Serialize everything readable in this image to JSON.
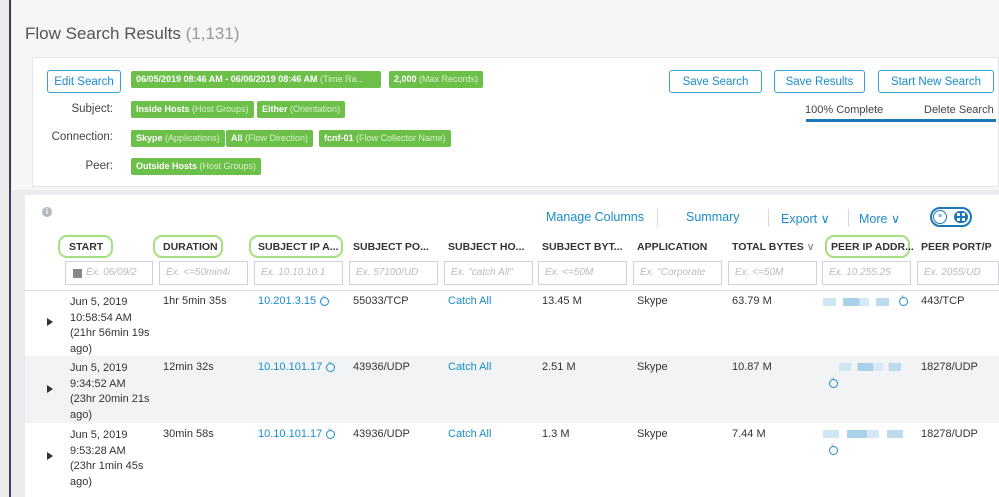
{
  "page": {
    "title": "Flow Search Results",
    "count": "(1,131)"
  },
  "search": {
    "edit_label": "Edit Search",
    "time_tag": {
      "bold": "06/05/2019 08:46 AM - 06/06/2019 08:46 AM",
      "light": "(Time Ra..."
    },
    "max_tag": {
      "bold": "2,000",
      "light": "(Max Records)"
    },
    "subject_label": "Subject:",
    "subject_tags": [
      {
        "bold": "Inside Hosts",
        "light": "(Host Groups)"
      },
      {
        "bold": "Either",
        "light": "(Orientation)"
      }
    ],
    "connection_label": "Connection:",
    "connection_tags": [
      {
        "bold": "Skype",
        "light": "(Applications)"
      },
      {
        "bold": "All",
        "light": "(Flow Direction)"
      },
      {
        "bold": "fcnf-01",
        "light": "(Flow Collector Name)"
      }
    ],
    "peer_label": "Peer:",
    "peer_tags": [
      {
        "bold": "Outside Hosts",
        "light": "(Host Groups)"
      }
    ],
    "save_search": "Save Search",
    "save_results": "Save Results",
    "start_new": "Start New Search",
    "progress_text": "100% Complete",
    "progress": 1.0,
    "delete_search": "Delete Search"
  },
  "toolbar": {
    "manage_columns": "Manage Columns",
    "summary": "Summary",
    "export": "Export",
    "more": "More",
    "chevron": "∨"
  },
  "columns": [
    {
      "label": "START",
      "placeholder": "Ex. 06/09/2"
    },
    {
      "label": "DURATION",
      "placeholder": "Ex. <=50min4i"
    },
    {
      "label": "SUBJECT IP A...",
      "placeholder": "Ex. 10.10.10.1"
    },
    {
      "label": "SUBJECT PO...",
      "placeholder": "Ex. 57100/UD"
    },
    {
      "label": "SUBJECT HO...",
      "placeholder": "Ex. \"catch All\""
    },
    {
      "label": "SUBJECT BYT...",
      "placeholder": "Ex. <=50M"
    },
    {
      "label": "APPLICATION",
      "placeholder": "Ex. \"Corporate"
    },
    {
      "label": "TOTAL BYTES",
      "placeholder": "Ex. <=50M"
    },
    {
      "label": "PEER IP ADDR...",
      "placeholder": "Ex. 10.255.25"
    },
    {
      "label": "PEER PORT/P",
      "placeholder": "Ex. 2055/UD"
    }
  ],
  "rows": [
    {
      "start": [
        "Jun 5, 2019",
        "10:58:54 AM",
        "(21hr 56min 19s",
        "ago)"
      ],
      "duration": "1hr 5min 35s",
      "subject_ip": "10.201.3.15",
      "subject_port": "55033/TCP",
      "subject_host": "Catch All",
      "subject_bytes": "13.45 M",
      "application": "Skype",
      "total_bytes": "63.79 M",
      "peer_port": "443/TCP"
    },
    {
      "start": [
        "Jun 5, 2019",
        "9:34:52 AM",
        "(23hr 20min 21s",
        "ago)"
      ],
      "duration": "12min 32s",
      "subject_ip": "10.10.101.17",
      "subject_port": "43936/UDP",
      "subject_host": "Catch All",
      "subject_bytes": "2.51 M",
      "application": "Skype",
      "total_bytes": "10.87 M",
      "peer_port": "18278/UDP"
    },
    {
      "start": [
        "Jun 5, 2019",
        "9:53:28 AM",
        "(23hr 1min 45s",
        "ago)"
      ],
      "duration": "30min 58s",
      "subject_ip": "10.10.101.17",
      "subject_port": "43936/UDP",
      "subject_host": "Catch All",
      "subject_bytes": "1.3 M",
      "application": "Skype",
      "total_bytes": "7.44 M",
      "peer_port": "18278/UDP"
    }
  ]
}
